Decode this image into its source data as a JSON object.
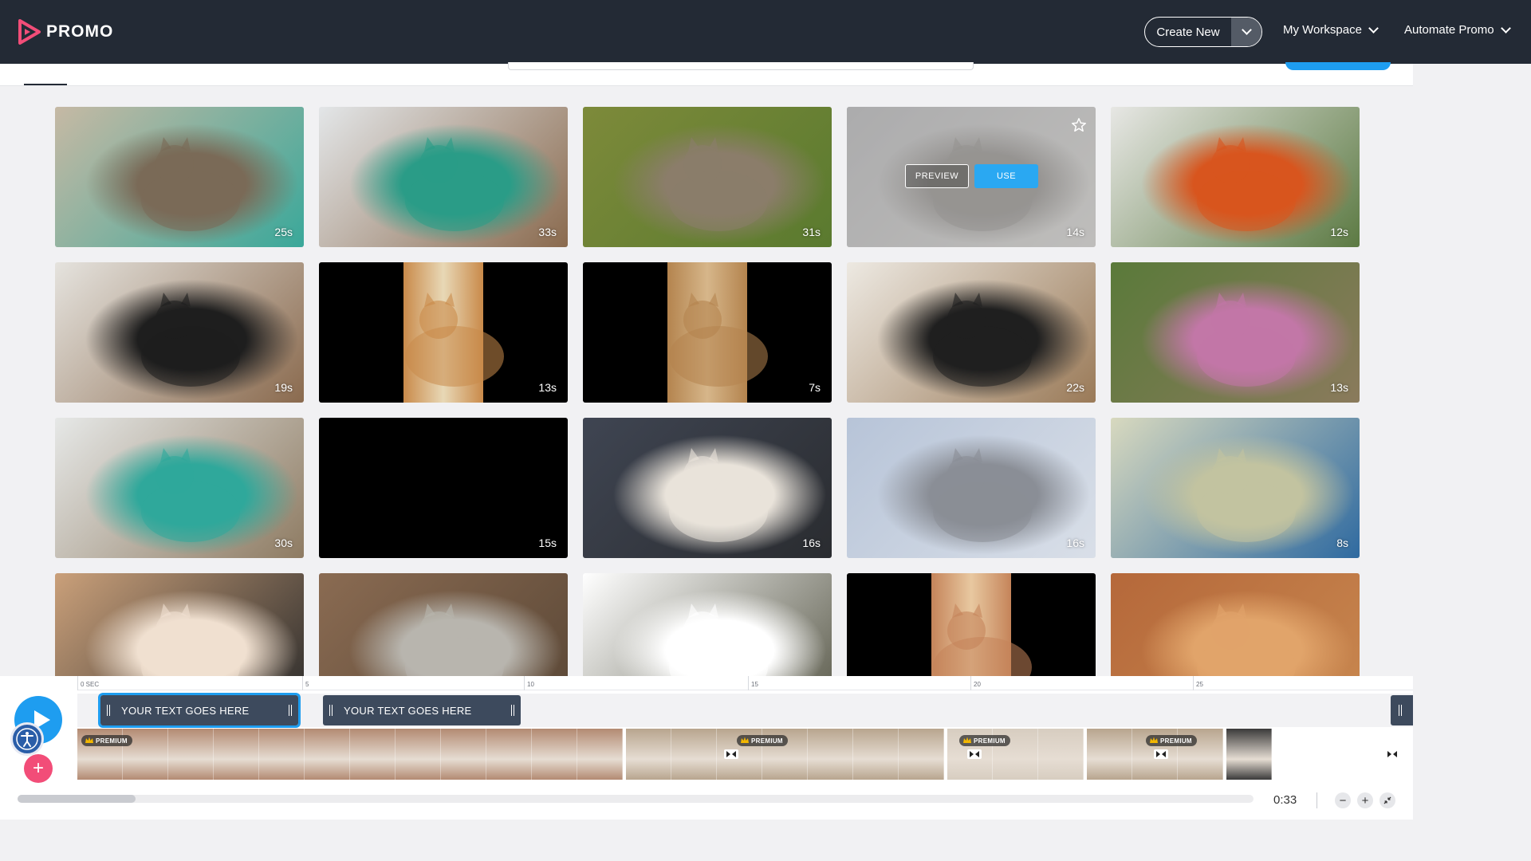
{
  "app": {
    "brand": "PROMO",
    "colors": {
      "topbar": "#232a35",
      "accent": "#1e9df0",
      "add": "#f24d78"
    }
  },
  "header": {
    "create_new": "Create New",
    "nav": [
      {
        "label": "My Workspace"
      },
      {
        "label": "Automate Promo"
      }
    ]
  },
  "grid": {
    "thumbnails": [
      {
        "duration": "25s",
        "palette": [
          "#c6b9a4",
          "#7a6a57",
          "#3aa89a"
        ],
        "desc": "cat-icon"
      },
      {
        "duration": "33s",
        "palette": [
          "#e3e6e8",
          "#2a9c87",
          "#8a6a4e"
        ],
        "desc": "cat-icon"
      },
      {
        "duration": "31s",
        "palette": [
          "#7d8a3a",
          "#8b7d6a",
          "#5a7a2f"
        ],
        "desc": "cat-icon"
      },
      {
        "duration": "14s",
        "palette": [
          "#b6b6b8",
          "#8e8a86",
          "#d8d6d2"
        ],
        "desc": "cat-icon",
        "hovered": true
      },
      {
        "duration": "12s",
        "palette": [
          "#e7e7e4",
          "#d8551e",
          "#5c7a43"
        ],
        "desc": "cat-icon"
      },
      {
        "duration": "19s",
        "palette": [
          "#e5e3de",
          "#1e1e1e",
          "#8a6a4e"
        ],
        "desc": "cat-icon"
      },
      {
        "duration": "13s",
        "palette": [
          "#000000",
          "#c98a4a",
          "#e8d8b6"
        ],
        "desc": "cat-icon",
        "letterbox": true
      },
      {
        "duration": "7s",
        "palette": [
          "#000000",
          "#b4844e",
          "#d6b68a"
        ],
        "desc": "cat-icon",
        "letterbox": true
      },
      {
        "duration": "22s",
        "palette": [
          "#ede9e2",
          "#1f1f1f",
          "#9a7a58"
        ],
        "desc": "cat-icon"
      },
      {
        "duration": "13s",
        "palette": [
          "#5a7a3a",
          "#c277a7",
          "#8a7a5c"
        ],
        "desc": "cat-icon"
      },
      {
        "duration": "30s",
        "palette": [
          "#e6e8e7",
          "#2fa89b",
          "#8e7b62"
        ],
        "desc": "cat-icon"
      },
      {
        "duration": "15s",
        "palette": [
          "#000000",
          "#000000",
          "#000000"
        ],
        "desc": "cat-icon"
      },
      {
        "duration": "16s",
        "palette": [
          "#3f4552",
          "#e9e3da",
          "#2a2c30"
        ],
        "desc": "cat-icon"
      },
      {
        "duration": "16s",
        "palette": [
          "#b7c4d8",
          "#8a8e96",
          "#d9dfe8"
        ],
        "desc": "cat-icon"
      },
      {
        "duration": "8s",
        "palette": [
          "#d8d9bf",
          "#c2c3a0",
          "#2f6aa0"
        ],
        "desc": "cat-icon"
      },
      {
        "duration": "",
        "palette": [
          "#caa07a",
          "#f0e0d0",
          "#2a2a2a"
        ],
        "desc": "cat-icon"
      },
      {
        "duration": "",
        "palette": [
          "#8a6b52",
          "#b8b5ae",
          "#5a4736"
        ],
        "desc": "cat-icon"
      },
      {
        "duration": "",
        "palette": [
          "#ffffff",
          "#ffffff",
          "#5a5a4a"
        ],
        "desc": "cat-icon"
      },
      {
        "duration": "",
        "palette": [
          "#000000",
          "#c5845a",
          "#e8c8a0"
        ],
        "desc": "cat-icon",
        "letterbox": true
      },
      {
        "duration": "",
        "palette": [
          "#b5683a",
          "#e1a46a",
          "#c8874f"
        ],
        "desc": "cat-icon"
      }
    ],
    "preview_label": "PREVIEW",
    "use_label": "USE"
  },
  "timeline": {
    "ticks": [
      "0 SEC",
      "5",
      "10",
      "15",
      "20",
      "25"
    ],
    "text_clips": [
      {
        "label": "YOUR TEXT GOES HERE",
        "selected": true
      },
      {
        "label": "YOUR TEXT GOES HERE",
        "selected": false
      }
    ],
    "premium_label": "PREMIUM",
    "time": "0:33",
    "clip_colors": {
      "festival": "#b38a72",
      "cat": "#b8a58e",
      "cat_light": "#d7cdc0",
      "dark": "#3a3a3a"
    }
  }
}
